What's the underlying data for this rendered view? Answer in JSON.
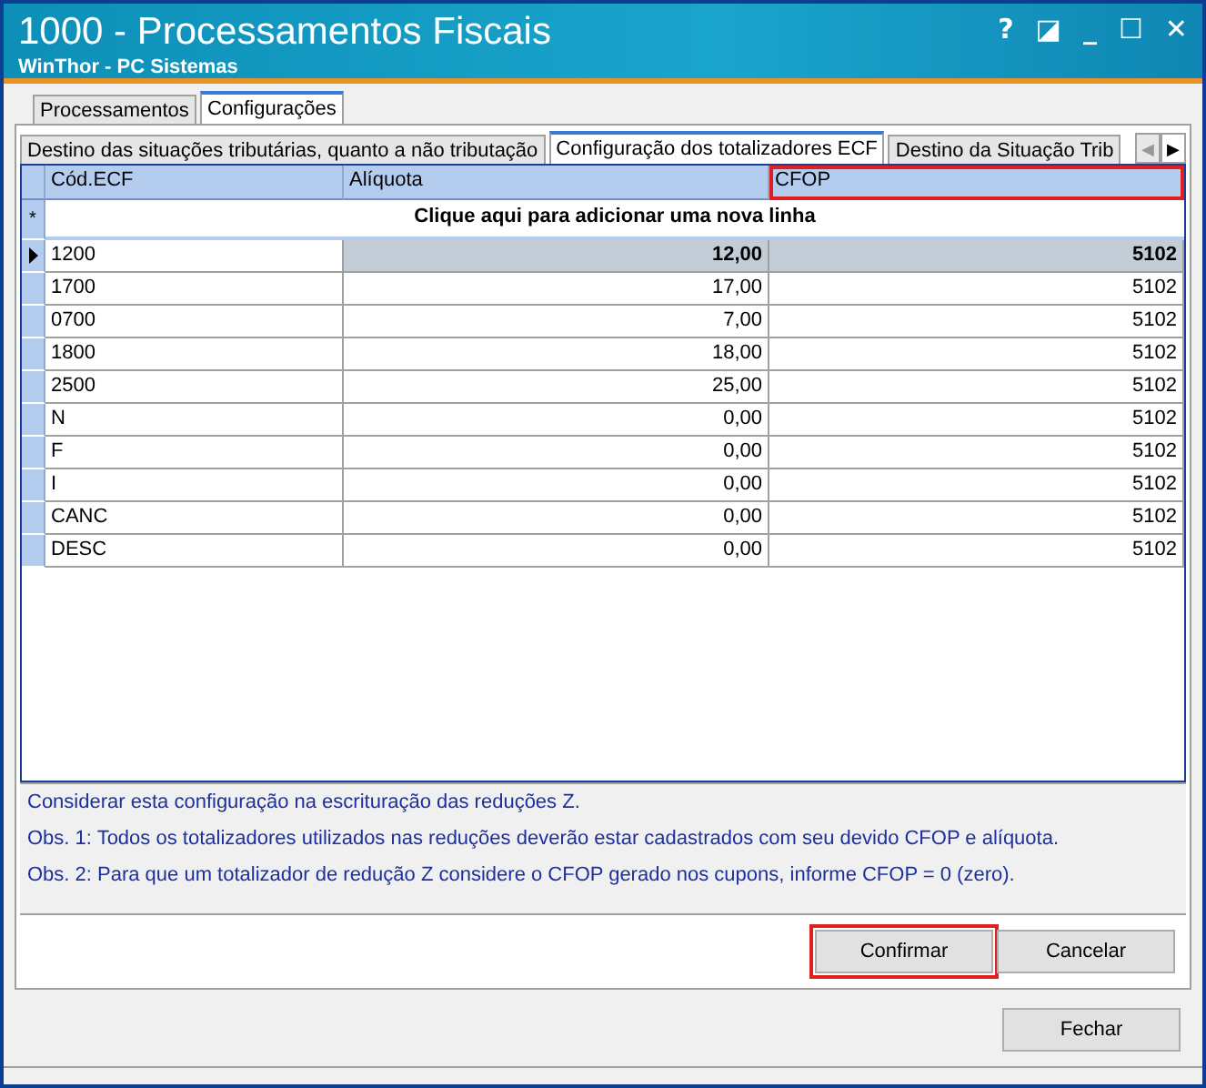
{
  "window": {
    "title": "1000 - Processamentos Fiscais",
    "subtitle": "WinThor - PC Sistemas",
    "controls": [
      "?",
      "◪",
      "_",
      "☐",
      "✕"
    ]
  },
  "tabs": [
    {
      "label": "Processamentos",
      "selected": false
    },
    {
      "label": "Configurações",
      "selected": true
    }
  ],
  "subtabs": [
    {
      "label": "Destino das situações tributárias, quanto a não tributação",
      "selected": false
    },
    {
      "label": "Configuração dos totalizadores ECF",
      "selected": true
    },
    {
      "label": "Destino da Situação Trib",
      "selected": false
    }
  ],
  "subtab_scroll": [
    "◀",
    "▶"
  ],
  "table": {
    "columns": [
      {
        "label": "Cód.ECF",
        "highlighted": false
      },
      {
        "label": "Alíquota",
        "highlighted": false
      },
      {
        "label": "CFOP",
        "highlighted": true
      }
    ],
    "new_row_marker": "*",
    "new_row_text": "Clique aqui para adicionar uma nova linha",
    "rows": [
      {
        "cells": [
          "1200",
          "12,00",
          "5102"
        ],
        "selected": true
      },
      {
        "cells": [
          "1700",
          "17,00",
          "5102"
        ],
        "selected": false
      },
      {
        "cells": [
          "0700",
          "7,00",
          "5102"
        ],
        "selected": false
      },
      {
        "cells": [
          "1800",
          "18,00",
          "5102"
        ],
        "selected": false
      },
      {
        "cells": [
          "2500",
          "25,00",
          "5102"
        ],
        "selected": false
      },
      {
        "cells": [
          "N",
          "0,00",
          "5102"
        ],
        "selected": false
      },
      {
        "cells": [
          "F",
          "0,00",
          "5102"
        ],
        "selected": false
      },
      {
        "cells": [
          "I",
          "0,00",
          "5102"
        ],
        "selected": false
      },
      {
        "cells": [
          "CANC",
          "0,00",
          "5102"
        ],
        "selected": false
      },
      {
        "cells": [
          "DESC",
          "0,00",
          "5102"
        ],
        "selected": false
      }
    ]
  },
  "notes": [
    "Considerar esta configuração na escrituração das reduções Z.",
    "Obs. 1: Todos os totalizadores utilizados nas reduções deverão estar cadastrados com seu devido CFOP e alíquota.",
    "Obs. 2: Para que um totalizador de redução Z considere o CFOP gerado nos cupons, informe CFOP = 0 (zero)."
  ],
  "buttons": [
    {
      "label": "Confirmar",
      "highlighted": true
    },
    {
      "label": "Cancelar",
      "highlighted": false
    }
  ],
  "footer_button": "Fechar"
}
